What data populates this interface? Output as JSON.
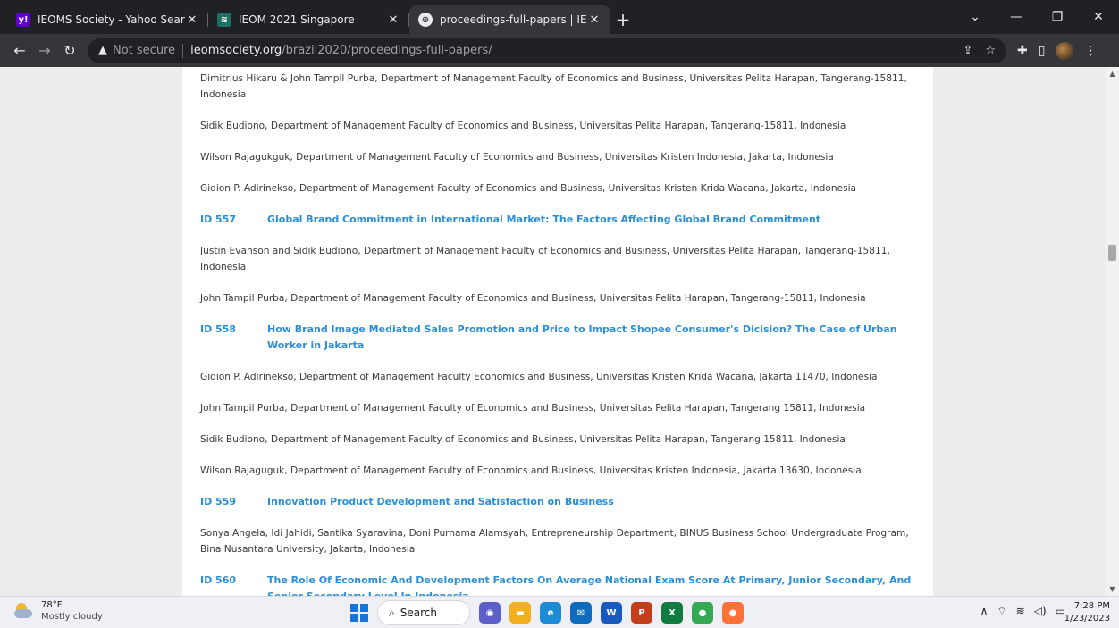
{
  "browser": {
    "tabs": [
      {
        "title": "IEOMS Society - Yahoo Search Re",
        "favicon": "yahoo-icon",
        "active": false
      },
      {
        "title": "IEOM 2021 Singapore",
        "favicon": "ieom-icon",
        "active": false
      },
      {
        "title": "proceedings-full-papers | IEOM E",
        "favicon": "globe-icon",
        "active": true
      }
    ],
    "new_tab_label": "+",
    "address": {
      "security_label": "Not secure",
      "host": "ieomsociety.org",
      "path": "/brazil2020/proceedings-full-papers/"
    }
  },
  "content": {
    "blocks": [
      {
        "kind": "author",
        "text": "Dimitrius Hikaru & John Tampil Purba, Department of Management Faculty of Economics and Business, Universitas Pelita Harapan, Tangerang-15811, Indonesia"
      },
      {
        "kind": "author",
        "text": "Sidik Budiono, Department of Management Faculty of Economics and Business, Universitas Pelita Harapan, Tangerang-15811, Indonesia"
      },
      {
        "kind": "author",
        "text": "Wilson Rajagukguk, Department of Management Faculty of Economics and Business, Universitas Kristen Indonesia, Jakarta, Indonesia"
      },
      {
        "kind": "author",
        "text": "Gidion P. Adirinekso, Department of Management Faculty of Economics and Business, Universitas Kristen Krida Wacana, Jakarta, Indonesia"
      },
      {
        "kind": "paper",
        "id": "ID 557",
        "title": "Global Brand Commitment in International Market: The Factors Affecting Global Brand Commitment"
      },
      {
        "kind": "author",
        "text": "Justin Evanson and Sidik Budiono, Department of Management Faculty of Economics and Business, Universitas Pelita Harapan, Tangerang-15811, Indonesia"
      },
      {
        "kind": "author",
        "text": "John Tampil Purba, Department of Management Faculty of Economics and Business, Universitas Pelita Harapan, Tangerang-15811, Indonesia"
      },
      {
        "kind": "paper",
        "id": "ID 558",
        "title": "How Brand Image Mediated Sales Promotion and Price to Impact Shopee Consumer's Dicision? The Case of Urban Worker in Jakarta"
      },
      {
        "kind": "author",
        "text": "Gidion P. Adirinekso, Department of Management Faculty Economics and Business, Universitas Kristen Krida Wacana, Jakarta 11470, Indonesia"
      },
      {
        "kind": "author",
        "text": "John Tampil Purba, Department of Management Faculty of Economics and Business, Universitas Pelita Harapan, Tangerang 15811, Indonesia"
      },
      {
        "kind": "author",
        "text": "Sidik Budiono, Department of Management Faculty of Economics and Business, Universitas Pelita Harapan, Tangerang 15811, Indonesia"
      },
      {
        "kind": "author",
        "text": "Wilson Rajaguguk, Department of Management Faculty of Economics and Business, Universitas Kristen Indonesia, Jakarta 13630, Indonesia"
      },
      {
        "kind": "paper",
        "id": "ID 559",
        "title": "Innovation Product Development and Satisfaction on Business"
      },
      {
        "kind": "author",
        "text": "Sonya Angela, Idi Jahidi, Santika Syaravina, Doni Purnama Alamsyah, Entrepreneurship Department, BINUS Business School Undergraduate Program, Bina Nusantara University, Jakarta, Indonesia"
      },
      {
        "kind": "paper",
        "id": "ID 560",
        "title": "The Role Of Economic And Development Factors On Average National Exam Score At Primary, Junior Secondary, And Senior Secondary Level In Indonesia"
      }
    ]
  },
  "taskbar": {
    "weather": {
      "temp": "78°F",
      "condition": "Mostly cloudy"
    },
    "search_label": "Search",
    "apps": [
      {
        "name": "meet-icon",
        "color": "#5b5fc7",
        "glyph": "◉"
      },
      {
        "name": "file-explorer-icon",
        "color": "#f2b01e",
        "glyph": "▬"
      },
      {
        "name": "edge-icon",
        "color": "#1e8bd6",
        "glyph": "e"
      },
      {
        "name": "mail-icon",
        "color": "#0f6cbd",
        "glyph": "✉"
      },
      {
        "name": "word-icon",
        "color": "#185abd",
        "glyph": "W"
      },
      {
        "name": "powerpoint-icon",
        "color": "#c43e1c",
        "glyph": "P"
      },
      {
        "name": "excel-icon",
        "color": "#107c41",
        "glyph": "X"
      },
      {
        "name": "chrome-icon",
        "color": "#34a853",
        "glyph": "●"
      },
      {
        "name": "firefox-icon",
        "color": "#ff7139",
        "glyph": "●"
      }
    ],
    "clock": {
      "time": "7:28 PM",
      "date": "1/23/2023"
    }
  }
}
